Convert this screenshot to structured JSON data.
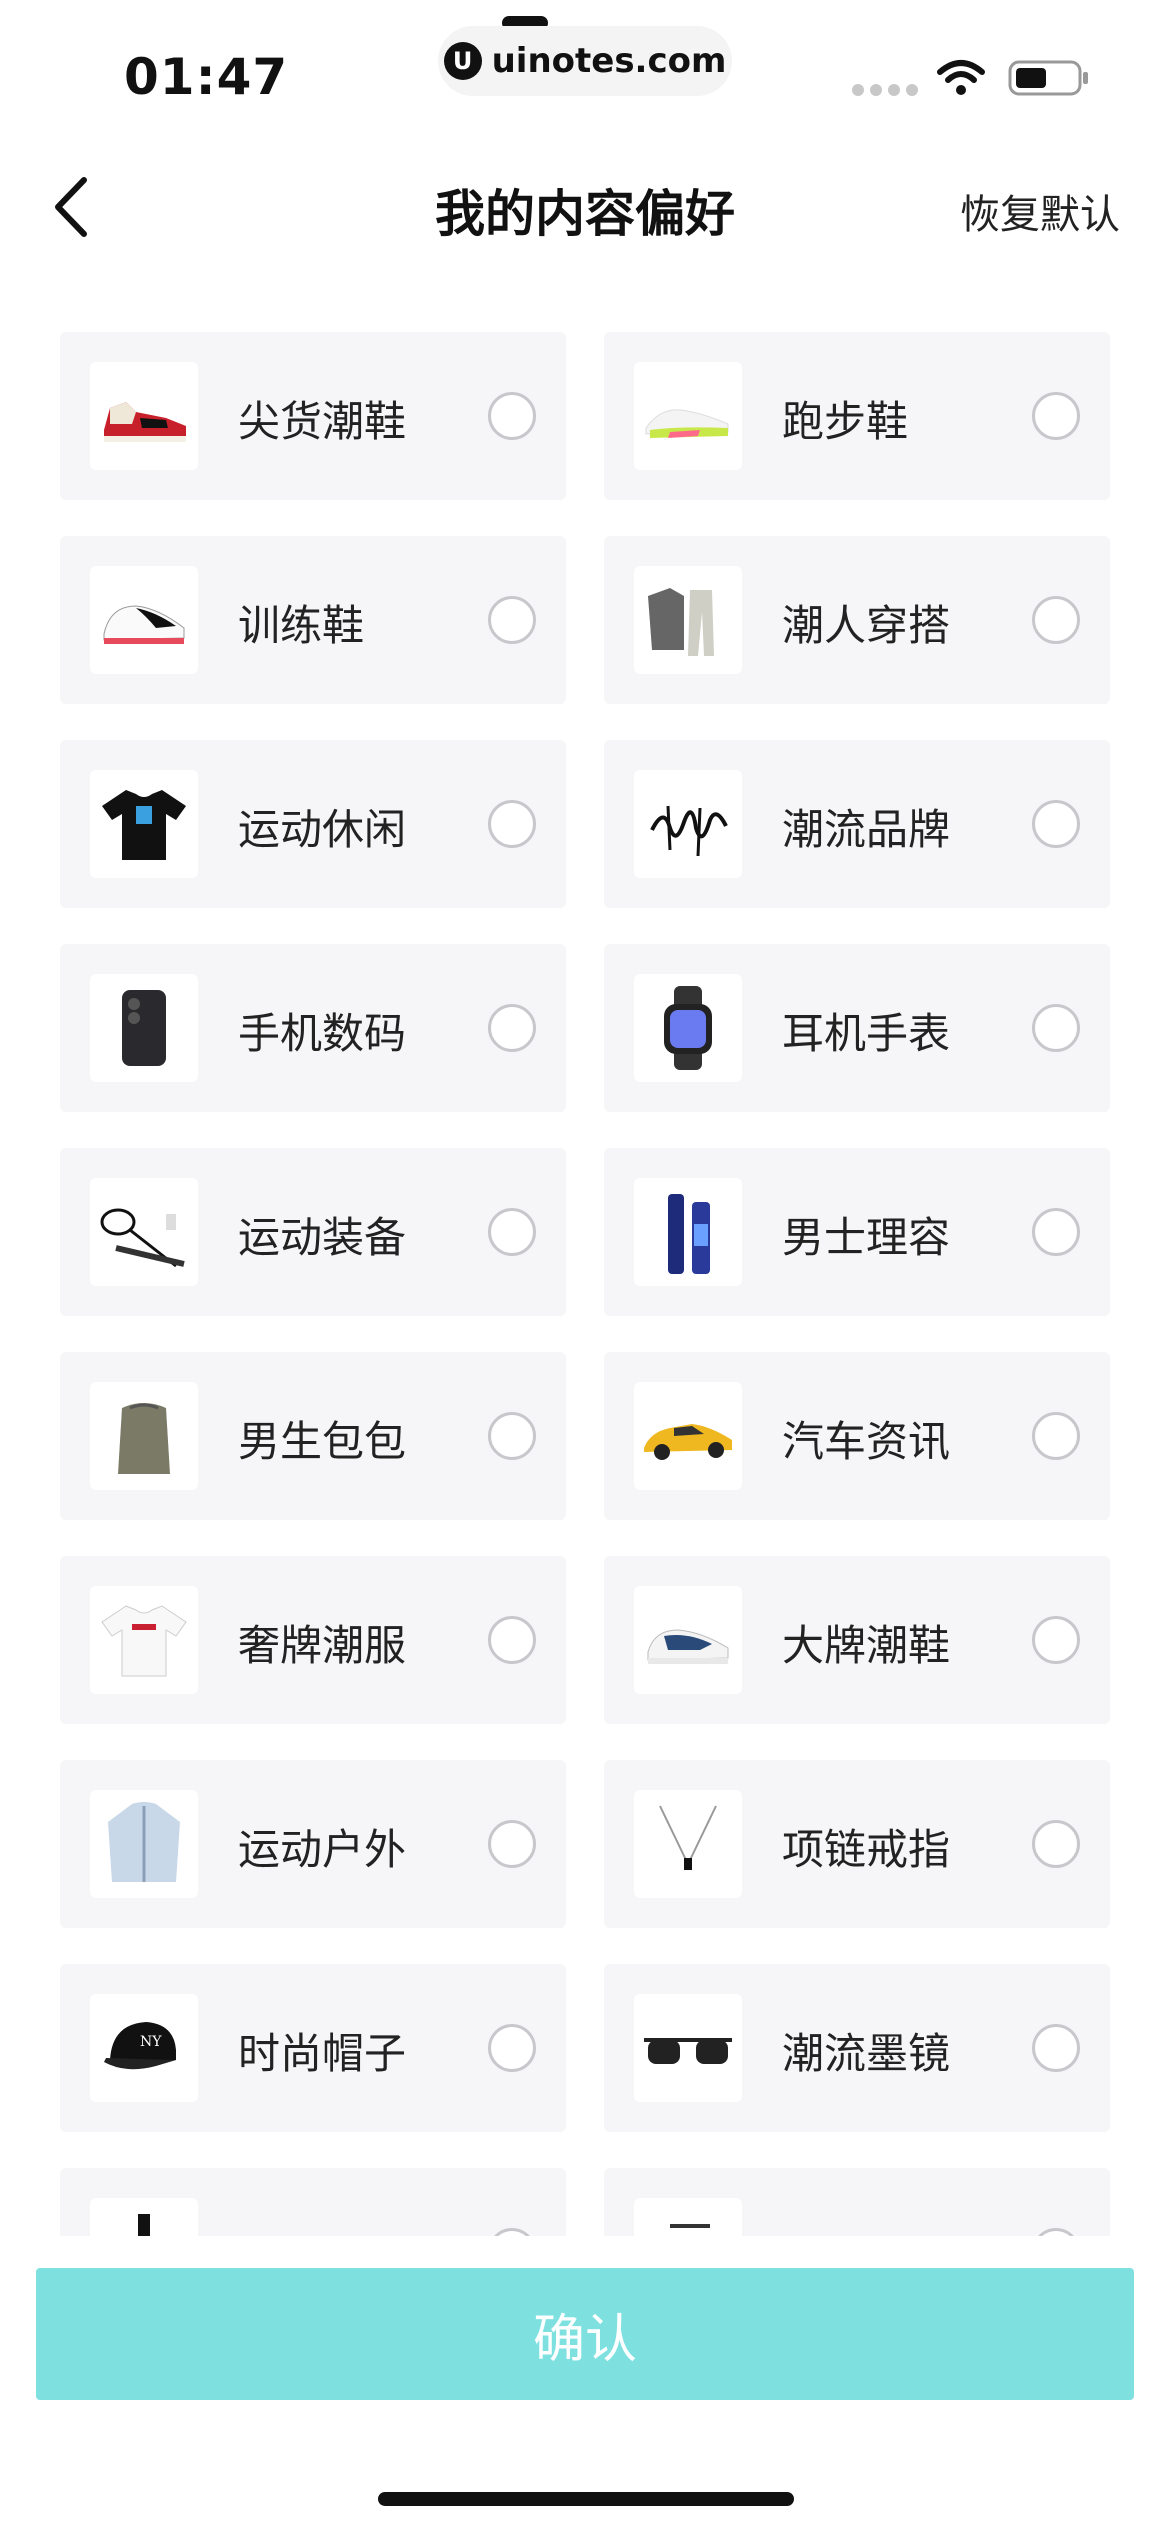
{
  "status_bar": {
    "time": "01:47",
    "url": "uinotes.com",
    "url_logo": "U"
  },
  "nav": {
    "title": "我的内容偏好",
    "reset_label": "恢复默认"
  },
  "categories": [
    {
      "label": "尖货潮鞋",
      "icon": "sneaker-icon"
    },
    {
      "label": "跑步鞋",
      "icon": "running-shoe-icon"
    },
    {
      "label": "训练鞋",
      "icon": "training-shoe-icon"
    },
    {
      "label": "潮人穿搭",
      "icon": "outfit-icon"
    },
    {
      "label": "运动休闲",
      "icon": "tshirt-icon"
    },
    {
      "label": "潮流品牌",
      "icon": "brand-logo-icon"
    },
    {
      "label": "手机数码",
      "icon": "phone-icon"
    },
    {
      "label": "耳机手表",
      "icon": "watch-icon"
    },
    {
      "label": "运动装备",
      "icon": "racket-icon"
    },
    {
      "label": "男士理容",
      "icon": "grooming-bottles-icon"
    },
    {
      "label": "男生包包",
      "icon": "backpack-icon"
    },
    {
      "label": "汽车资讯",
      "icon": "car-icon"
    },
    {
      "label": "奢牌潮服",
      "icon": "luxury-tshirt-icon"
    },
    {
      "label": "大牌潮鞋",
      "icon": "designer-sneaker-icon"
    },
    {
      "label": "运动户外",
      "icon": "jacket-icon"
    },
    {
      "label": "项链戒指",
      "icon": "necklace-icon"
    },
    {
      "label": "时尚帽子",
      "icon": "cap-icon"
    },
    {
      "label": "潮流墨镜",
      "icon": "sunglasses-icon"
    },
    {
      "label": "",
      "icon": "perfume-icon"
    },
    {
      "label": "",
      "icon": "accessory-icon"
    }
  ],
  "confirm_label": "确认",
  "colors": {
    "accent": "#7fe0e0",
    "card_bg": "#f6f6f8",
    "radio_border": "#c8c8cc"
  }
}
